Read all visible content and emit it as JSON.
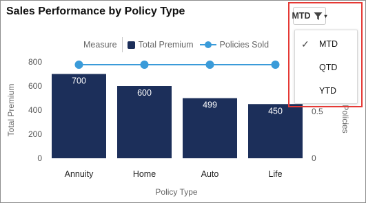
{
  "title": "Sales Performance by Policy Type",
  "legend": {
    "title": "Measure",
    "items": [
      {
        "label": "Total Premium",
        "kind": "bar",
        "color": "#1c2f5a"
      },
      {
        "label": "Policies Sold",
        "kind": "line",
        "color": "#3a9bd9"
      }
    ]
  },
  "filter": {
    "selected": "MTD",
    "icon": "filter-icon",
    "chevron": "▾",
    "options": [
      {
        "label": "MTD",
        "checked": true
      },
      {
        "label": "QTD",
        "checked": false
      },
      {
        "label": "YTD",
        "checked": false
      }
    ],
    "check_glyph": "✓",
    "highlight_color": "#e53935"
  },
  "chart_data": {
    "type": "bar",
    "categories": [
      "Annuity",
      "Home",
      "Auto",
      "Life"
    ],
    "series": [
      {
        "name": "Total Premium",
        "kind": "bar",
        "axis": "left",
        "values": [
          700,
          600,
          499,
          450
        ],
        "color": "#1c2f5a"
      },
      {
        "name": "Policies Sold",
        "kind": "line",
        "axis": "right",
        "values": [
          1,
          1,
          1,
          1
        ],
        "color": "#3a9bd9"
      }
    ],
    "data_labels": [
      "700",
      "600",
      "499",
      "450"
    ],
    "xlabel": "Policy Type",
    "ylabel": "Total Premium",
    "ylabel_right": "Policies",
    "ylim": [
      0,
      800
    ],
    "yticks": [
      "0",
      "200",
      "400",
      "600",
      "800"
    ],
    "ylim_right": [
      0,
      1
    ],
    "yticks_right": [
      "0",
      "0.5"
    ],
    "grid": false,
    "legend_position": "top"
  }
}
